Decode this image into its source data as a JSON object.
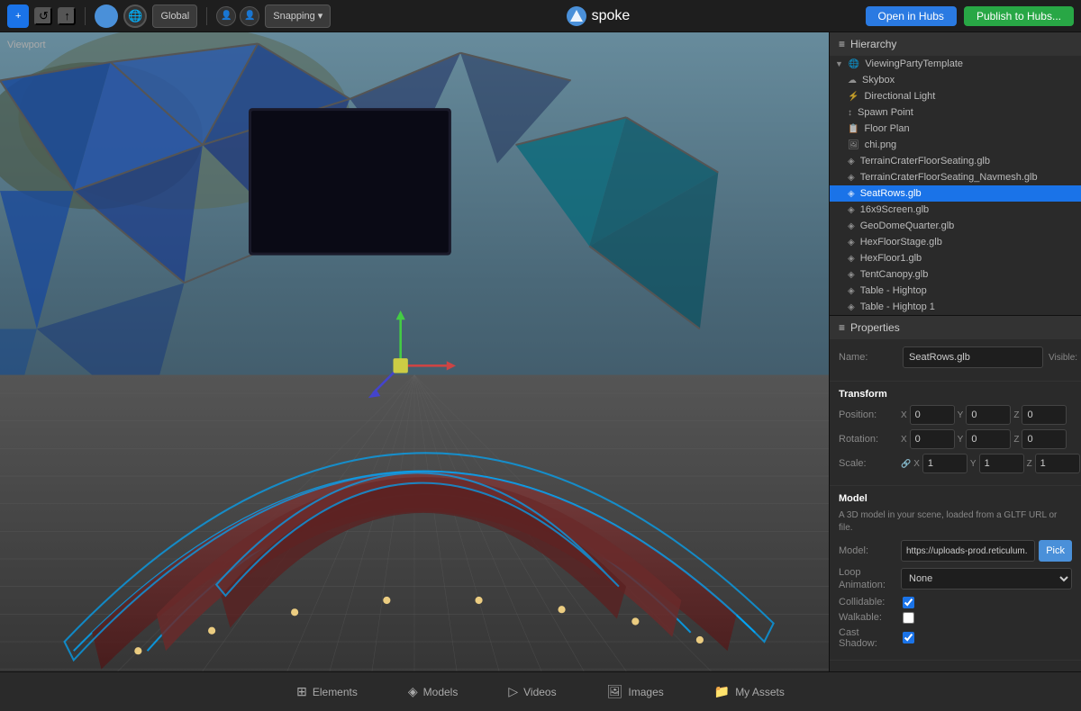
{
  "toolbar": {
    "add_label": "+",
    "refresh_label": "↺",
    "upload_label": "↑",
    "transform_label": "Global",
    "snapping_label": "Snapping ▾",
    "logo_text": "spoke",
    "open_btn": "Open in Hubs",
    "publish_btn": "Publish to Hubs..."
  },
  "viewport": {
    "label": "Viewport"
  },
  "bottom_tabs": [
    {
      "icon": "⊞",
      "label": "Elements"
    },
    {
      "icon": "◈",
      "label": "Models"
    },
    {
      "icon": "▷",
      "label": "Videos"
    },
    {
      "icon": "🖼",
      "label": "Images"
    },
    {
      "icon": "📁",
      "label": "My Assets"
    }
  ],
  "hierarchy": {
    "title": "Hierarchy",
    "items": [
      {
        "id": "root",
        "label": "ViewingPartyTemplate",
        "icon": "🌐",
        "indent": 0,
        "arrow": "▼",
        "selected": false
      },
      {
        "id": "skybox",
        "label": "Skybox",
        "icon": "☁",
        "indent": 1,
        "selected": false
      },
      {
        "id": "dirlight",
        "label": "Directional Light",
        "icon": "⚡",
        "indent": 1,
        "selected": false
      },
      {
        "id": "spawn",
        "label": "Spawn Point",
        "icon": "↕",
        "indent": 1,
        "selected": false
      },
      {
        "id": "floorplan",
        "label": "Floor Plan",
        "icon": "📋",
        "indent": 1,
        "selected": false
      },
      {
        "id": "chipng",
        "label": "chi.png",
        "icon": "🖼",
        "indent": 1,
        "selected": false
      },
      {
        "id": "terrain1",
        "label": "TerrainCraterFloorSeating.glb",
        "icon": "◈",
        "indent": 1,
        "selected": false
      },
      {
        "id": "terrain2",
        "label": "TerrainCraterFloorSeating_Navmesh.glb",
        "icon": "◈",
        "indent": 1,
        "selected": false
      },
      {
        "id": "seatrows",
        "label": "SeatRows.glb",
        "icon": "◈",
        "indent": 1,
        "selected": true
      },
      {
        "id": "screen",
        "label": "16x9Screen.glb",
        "icon": "◈",
        "indent": 1,
        "selected": false
      },
      {
        "id": "geodome",
        "label": "GeoDomeQuarter.glb",
        "icon": "◈",
        "indent": 1,
        "selected": false
      },
      {
        "id": "hexfloorstage",
        "label": "HexFloorStage.glb",
        "icon": "◈",
        "indent": 1,
        "selected": false
      },
      {
        "id": "hexfloor1",
        "label": "HexFloor1.glb",
        "icon": "◈",
        "indent": 1,
        "selected": false
      },
      {
        "id": "tentcanopy",
        "label": "TentCanopy.glb",
        "icon": "◈",
        "indent": 1,
        "selected": false
      },
      {
        "id": "tablehigh",
        "label": "Table - Hightop",
        "icon": "◈",
        "indent": 1,
        "selected": false
      },
      {
        "id": "tablehigh1",
        "label": "Table - Hightop 1",
        "icon": "◈",
        "indent": 1,
        "selected": false
      }
    ]
  },
  "properties": {
    "title": "Properties",
    "name_label": "Name:",
    "name_value": "SeatRows.glb",
    "visible_label": "Visible:",
    "transform_title": "Transform",
    "position_label": "Position:",
    "position": {
      "x": "0",
      "y": "0",
      "z": "0"
    },
    "rotation_label": "Rotation:",
    "rotation": {
      "x": "0",
      "y": "0",
      "z": "0"
    },
    "scale_label": "Scale:",
    "scale": {
      "x": "1",
      "y": "1",
      "z": "1"
    },
    "model_title": "Model",
    "model_desc": "A 3D model in your scene, loaded from a GLTF URL or file.",
    "model_label": "Model:",
    "model_url": "https://uploads-prod.reticulum.",
    "pick_label": "Pick",
    "loop_anim_label": "Loop\nAnimation:",
    "loop_anim_value": "None",
    "collidable_label": "Collidable:",
    "walkable_label": "Walkable:",
    "cast_shadow_label": "Cast Shadow:"
  }
}
